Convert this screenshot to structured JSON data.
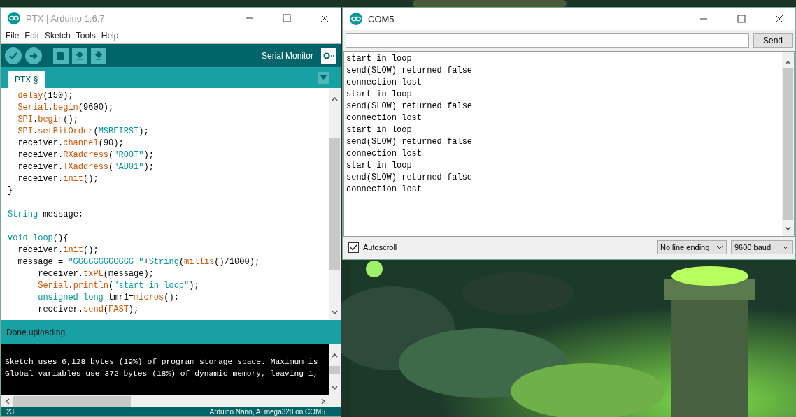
{
  "ide": {
    "title": "PTX | Arduino 1.6.7",
    "menu": [
      "File",
      "Edit",
      "Sketch",
      "Tools",
      "Help"
    ],
    "toolbar": {
      "serial_monitor_label": "Serial Monitor"
    },
    "tabs": [
      {
        "label": "PTX §",
        "selected": true
      }
    ],
    "code_lines": [
      {
        "tokens": [
          {
            "text": "  delay",
            "kind": "function"
          },
          {
            "text": "(150);",
            "kind": "plain"
          }
        ]
      },
      {
        "tokens": [
          {
            "text": "  Serial",
            "kind": "function"
          },
          {
            "text": ".",
            "kind": "plain"
          },
          {
            "text": "begin",
            "kind": "function"
          },
          {
            "text": "(9600);",
            "kind": "plain"
          }
        ]
      },
      {
        "tokens": [
          {
            "text": "  SPI",
            "kind": "function"
          },
          {
            "text": ".",
            "kind": "plain"
          },
          {
            "text": "begin",
            "kind": "function"
          },
          {
            "text": "();",
            "kind": "plain"
          }
        ]
      },
      {
        "tokens": [
          {
            "text": "  SPI",
            "kind": "function"
          },
          {
            "text": ".",
            "kind": "plain"
          },
          {
            "text": "setBitOrder",
            "kind": "function"
          },
          {
            "text": "(",
            "kind": "plain"
          },
          {
            "text": "MSBFIRST",
            "kind": "keyword"
          },
          {
            "text": ");",
            "kind": "plain"
          }
        ]
      },
      {
        "tokens": [
          {
            "text": "  receiver.",
            "kind": "plain"
          },
          {
            "text": "channel",
            "kind": "function"
          },
          {
            "text": "(90);",
            "kind": "plain"
          }
        ]
      },
      {
        "tokens": [
          {
            "text": "  receiver.",
            "kind": "plain"
          },
          {
            "text": "RXaddress",
            "kind": "function"
          },
          {
            "text": "(",
            "kind": "plain"
          },
          {
            "text": "\"ROOT\"",
            "kind": "string"
          },
          {
            "text": ");",
            "kind": "plain"
          }
        ]
      },
      {
        "tokens": [
          {
            "text": "  receiver.",
            "kind": "plain"
          },
          {
            "text": "TXaddress",
            "kind": "function"
          },
          {
            "text": "(",
            "kind": "plain"
          },
          {
            "text": "\"AD01\"",
            "kind": "string"
          },
          {
            "text": ");",
            "kind": "plain"
          }
        ]
      },
      {
        "tokens": [
          {
            "text": "  receiver.",
            "kind": "plain"
          },
          {
            "text": "init",
            "kind": "function"
          },
          {
            "text": "();",
            "kind": "plain"
          }
        ]
      },
      {
        "tokens": [
          {
            "text": "}",
            "kind": "plain"
          }
        ]
      },
      {
        "kind": "blank"
      },
      {
        "tokens": [
          {
            "text": "String",
            "kind": "keyword"
          },
          {
            "text": " message;",
            "kind": "plain"
          }
        ]
      },
      {
        "kind": "blank"
      },
      {
        "tokens": [
          {
            "text": "void loop",
            "kind": "keyword"
          },
          {
            "text": "(){",
            "kind": "plain"
          }
        ]
      },
      {
        "tokens": [
          {
            "text": "  receiver.",
            "kind": "plain"
          },
          {
            "text": "init",
            "kind": "function"
          },
          {
            "text": "();",
            "kind": "plain"
          }
        ]
      },
      {
        "tokens": [
          {
            "text": "  message = ",
            "kind": "plain"
          },
          {
            "text": "\"GGGGGGGGGGGG \"",
            "kind": "string"
          },
          {
            "text": "+",
            "kind": "plain"
          },
          {
            "text": "String",
            "kind": "keyword"
          },
          {
            "text": "(",
            "kind": "plain"
          },
          {
            "text": "millis",
            "kind": "function"
          },
          {
            "text": "()/1000);",
            "kind": "plain"
          }
        ]
      },
      {
        "tokens": [
          {
            "text": "      receiver.",
            "kind": "plain"
          },
          {
            "text": "txPL",
            "kind": "function"
          },
          {
            "text": "(message);",
            "kind": "plain"
          }
        ]
      },
      {
        "tokens": [
          {
            "text": "      Serial",
            "kind": "function"
          },
          {
            "text": ".",
            "kind": "plain"
          },
          {
            "text": "println",
            "kind": "function"
          },
          {
            "text": "(",
            "kind": "plain"
          },
          {
            "text": "\"start in loop\"",
            "kind": "string"
          },
          {
            "text": ");",
            "kind": "plain"
          }
        ]
      },
      {
        "tokens": [
          {
            "text": "      unsigned long",
            "kind": "keyword"
          },
          {
            "text": " tmr1=",
            "kind": "plain"
          },
          {
            "text": "micros",
            "kind": "function"
          },
          {
            "text": "();",
            "kind": "plain"
          }
        ]
      },
      {
        "tokens": [
          {
            "text": "      receiver.",
            "kind": "plain"
          },
          {
            "text": "send",
            "kind": "function"
          },
          {
            "text": "(",
            "kind": "plain"
          },
          {
            "text": "FAST",
            "kind": "function"
          },
          {
            "text": ");",
            "kind": "plain"
          }
        ]
      }
    ],
    "status_message": "Done uploading.",
    "console_lines": [
      "Sketch uses 6,128 bytes (19%) of program storage space. Maximum is",
      "Global variables use 372 bytes (18%) of dynamic memory, leaving 1,"
    ],
    "footer": {
      "line_number": "23",
      "board": "Arduino Nano, ATmega328 on COM5"
    }
  },
  "serial_monitor": {
    "title": "COM5",
    "send_button": "Send",
    "output_lines": [
      "start in loop",
      "send(SLOW) returned false",
      "connection lost",
      "start in loop",
      "send(SLOW) returned false",
      "connection lost",
      "start in loop",
      "send(SLOW) returned false",
      "connection lost",
      "start in loop",
      "send(SLOW) returned false",
      "connection lost"
    ],
    "autoscroll": {
      "label": "Autoscroll",
      "checked": true
    },
    "line_ending": "No line ending",
    "baud_rate": "9600 baud"
  }
}
